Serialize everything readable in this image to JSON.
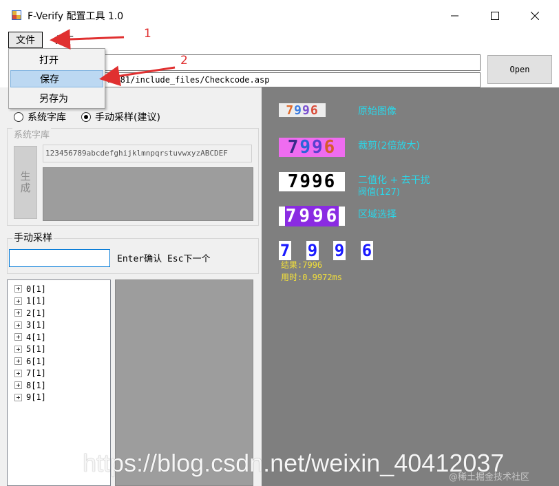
{
  "window": {
    "title": "F-Verify 配置工具 1.0",
    "minimize_icon": "minimize-icon",
    "maximize_icon": "maximize-icon",
    "close_icon": "close-icon"
  },
  "menu": {
    "file": "文件",
    "about": "关于",
    "file_items": [
      "打开",
      "保存",
      "另存为"
    ]
  },
  "toolbar": {
    "path_value": "",
    "url_value": "40:81/include_files/Checkcode.asp",
    "open_label": "Open"
  },
  "left": {
    "radio_system": "系统字库",
    "radio_manual": "手动采样(建议)",
    "selected_radio": "manual",
    "system_group_title": "系统字库",
    "generate_label": "生成",
    "charset_value": "123456789abcdefghijklmnpqrstuvwxyzABCDEF",
    "manual_group_title": "手动采样",
    "manual_input_value": "",
    "manual_hint": "Enter确认 Esc下一个",
    "tree_nodes": [
      "0[1]",
      "1[1]",
      "2[1]",
      "3[1]",
      "4[1]",
      "5[1]",
      "6[1]",
      "7[1]",
      "8[1]",
      "9[1]"
    ]
  },
  "right": {
    "original_label": "原始图像",
    "crop_label": "裁剪(2倍放大)",
    "binary_label_1": "二值化 + 去干扰",
    "binary_label_2": "阀值(127)",
    "region_label": "区域选择",
    "captcha_digits": [
      "7",
      "9",
      "9",
      "6"
    ],
    "result_text": "结果:7996",
    "time_text": "用时:0.9972ms"
  },
  "annotations": {
    "step1": "1",
    "step2": "2"
  },
  "watermark": {
    "url": "https://blog.csdn.net/weixin_40412037",
    "community": "@稀土掘金技术社区"
  },
  "colors": {
    "accent_cyan": "#2bd6e8",
    "result_yellow": "#f3e03a",
    "arrow_red": "#e03030",
    "selection_blue": "#bcd8f2"
  }
}
